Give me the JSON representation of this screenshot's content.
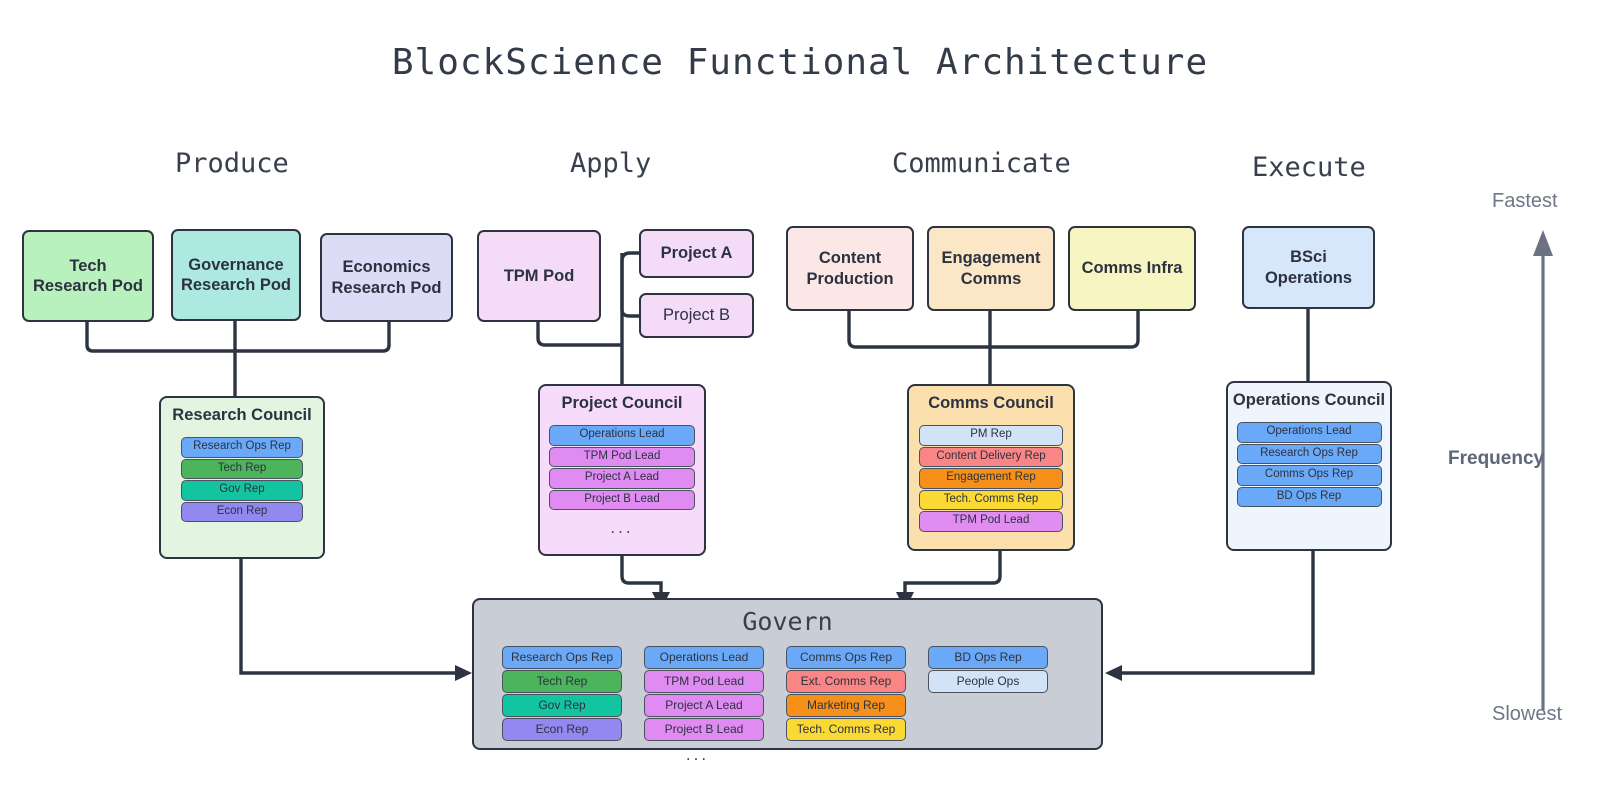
{
  "title": "BlockScience Functional Architecture",
  "columns": [
    {
      "label": "Produce"
    },
    {
      "label": "Apply"
    },
    {
      "label": "Communicate"
    },
    {
      "label": "Execute"
    }
  ],
  "pods": {
    "tech_research": "Tech\nResearch Pod",
    "governance_research": "Governance\nResearch Pod",
    "economics_research": "Economics\nResearch Pod",
    "tpm_pod": "TPM Pod",
    "project_a": "Project A",
    "project_b": "Project B",
    "content_production": "Content\nProduction",
    "engagement_comms": "Engagement\nComms",
    "comms_infra": "Comms Infra",
    "bsci_operations": "BSci\nOperations"
  },
  "councils": {
    "research": {
      "title": "Research Council",
      "reps": [
        {
          "label": "Research Ops Rep",
          "color": "#6aa9f7"
        },
        {
          "label": "Tech Rep",
          "color": "#4cb45b"
        },
        {
          "label": "Gov Rep",
          "color": "#12c4a0"
        },
        {
          "label": "Econ Rep",
          "color": "#9387f0"
        }
      ],
      "ellipsis": ""
    },
    "project": {
      "title": "Project Council",
      "reps": [
        {
          "label": "Operations Lead",
          "color": "#6aa9f7"
        },
        {
          "label": "TPM Pod Lead",
          "color": "#df8bf2"
        },
        {
          "label": "Project A Lead",
          "color": "#df8bf2"
        },
        {
          "label": "Project B Lead",
          "color": "#df8bf2"
        }
      ],
      "ellipsis": "..."
    },
    "comms": {
      "title": "Comms Council",
      "reps": [
        {
          "label": "PM Rep",
          "color": "#d2e3f7"
        },
        {
          "label": "Content Delivery Rep",
          "color": "#fa8585"
        },
        {
          "label": "Engagement Rep",
          "color": "#f79019"
        },
        {
          "label": "Tech. Comms Rep",
          "color": "#fbd935"
        },
        {
          "label": "TPM Pod Lead",
          "color": "#e08cf0"
        }
      ],
      "ellipsis": ""
    },
    "operations": {
      "title": "Operations Council",
      "reps": [
        {
          "label": "Operations Lead",
          "color": "#6aa9f7"
        },
        {
          "label": "Research Ops Rep",
          "color": "#6aa9f7"
        },
        {
          "label": "Comms Ops Rep",
          "color": "#6aa9f7"
        },
        {
          "label": "BD Ops Rep",
          "color": "#6aa9f7"
        }
      ],
      "ellipsis": ""
    }
  },
  "govern": {
    "title": "Govern",
    "ellipsis": "...",
    "groups": [
      {
        "name": "research-group",
        "reps": [
          {
            "label": "Research Ops Rep",
            "color": "#6aa9f7"
          },
          {
            "label": "Tech Rep",
            "color": "#4cb45b"
          },
          {
            "label": "Gov Rep",
            "color": "#12c4a0"
          },
          {
            "label": "Econ Rep",
            "color": "#9387f0"
          }
        ]
      },
      {
        "name": "project-group",
        "reps": [
          {
            "label": "Operations Lead",
            "color": "#6aa9f7"
          },
          {
            "label": "TPM Pod Lead",
            "color": "#df8bf2"
          },
          {
            "label": "Project A Lead",
            "color": "#df8bf2"
          },
          {
            "label": "Project B Lead",
            "color": "#df8bf2"
          }
        ]
      },
      {
        "name": "comms-group",
        "reps": [
          {
            "label": "Comms Ops Rep",
            "color": "#6aa9f7"
          },
          {
            "label": "Ext. Comms Rep",
            "color": "#fa8585"
          },
          {
            "label": "Marketing Rep",
            "color": "#f79019"
          },
          {
            "label": "Tech. Comms Rep",
            "color": "#fbd935"
          }
        ]
      },
      {
        "name": "operations-group",
        "reps": [
          {
            "label": "BD Ops Rep",
            "color": "#6aa9f7"
          },
          {
            "label": "People Ops",
            "color": "#d2e3f7"
          }
        ]
      }
    ]
  },
  "axis": {
    "top_label": "Fastest",
    "middle_label": "Frequency",
    "bottom_label": "Slowest"
  },
  "colors": {
    "tech_research": "#b8f0be",
    "governance_research": "#ade9e0",
    "economics_research": "#dcdcf7",
    "tpm_pod": "#f4dcf9",
    "project": "#f4dcf9",
    "content_production": "#fbe8e6",
    "engagement_comms": "#fbe7c6",
    "comms_infra": "#f7f6c2",
    "bsci_operations": "#d6e6fb",
    "research_council": "#e3f5e0",
    "project_council": "#f6dcfa",
    "comms_council": "#fbdfac",
    "operations_council": "#eff5fd",
    "govern": "#c9ced6",
    "stroke": "#2d3441"
  }
}
